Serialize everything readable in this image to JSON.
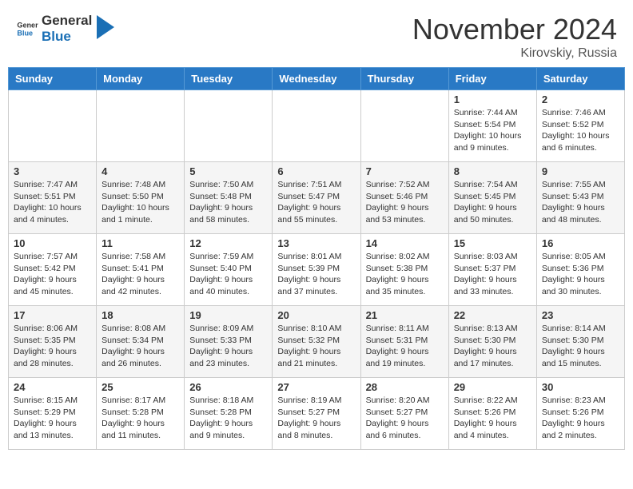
{
  "header": {
    "logo_line1": "General",
    "logo_line2": "Blue",
    "month": "November 2024",
    "location": "Kirovskiy, Russia"
  },
  "weekdays": [
    "Sunday",
    "Monday",
    "Tuesday",
    "Wednesday",
    "Thursday",
    "Friday",
    "Saturday"
  ],
  "weeks": [
    [
      {
        "day": "",
        "info": ""
      },
      {
        "day": "",
        "info": ""
      },
      {
        "day": "",
        "info": ""
      },
      {
        "day": "",
        "info": ""
      },
      {
        "day": "",
        "info": ""
      },
      {
        "day": "1",
        "info": "Sunrise: 7:44 AM\nSunset: 5:54 PM\nDaylight: 10 hours\nand 9 minutes."
      },
      {
        "day": "2",
        "info": "Sunrise: 7:46 AM\nSunset: 5:52 PM\nDaylight: 10 hours\nand 6 minutes."
      }
    ],
    [
      {
        "day": "3",
        "info": "Sunrise: 7:47 AM\nSunset: 5:51 PM\nDaylight: 10 hours\nand 4 minutes."
      },
      {
        "day": "4",
        "info": "Sunrise: 7:48 AM\nSunset: 5:50 PM\nDaylight: 10 hours\nand 1 minute."
      },
      {
        "day": "5",
        "info": "Sunrise: 7:50 AM\nSunset: 5:48 PM\nDaylight: 9 hours\nand 58 minutes."
      },
      {
        "day": "6",
        "info": "Sunrise: 7:51 AM\nSunset: 5:47 PM\nDaylight: 9 hours\nand 55 minutes."
      },
      {
        "day": "7",
        "info": "Sunrise: 7:52 AM\nSunset: 5:46 PM\nDaylight: 9 hours\nand 53 minutes."
      },
      {
        "day": "8",
        "info": "Sunrise: 7:54 AM\nSunset: 5:45 PM\nDaylight: 9 hours\nand 50 minutes."
      },
      {
        "day": "9",
        "info": "Sunrise: 7:55 AM\nSunset: 5:43 PM\nDaylight: 9 hours\nand 48 minutes."
      }
    ],
    [
      {
        "day": "10",
        "info": "Sunrise: 7:57 AM\nSunset: 5:42 PM\nDaylight: 9 hours\nand 45 minutes."
      },
      {
        "day": "11",
        "info": "Sunrise: 7:58 AM\nSunset: 5:41 PM\nDaylight: 9 hours\nand 42 minutes."
      },
      {
        "day": "12",
        "info": "Sunrise: 7:59 AM\nSunset: 5:40 PM\nDaylight: 9 hours\nand 40 minutes."
      },
      {
        "day": "13",
        "info": "Sunrise: 8:01 AM\nSunset: 5:39 PM\nDaylight: 9 hours\nand 37 minutes."
      },
      {
        "day": "14",
        "info": "Sunrise: 8:02 AM\nSunset: 5:38 PM\nDaylight: 9 hours\nand 35 minutes."
      },
      {
        "day": "15",
        "info": "Sunrise: 8:03 AM\nSunset: 5:37 PM\nDaylight: 9 hours\nand 33 minutes."
      },
      {
        "day": "16",
        "info": "Sunrise: 8:05 AM\nSunset: 5:36 PM\nDaylight: 9 hours\nand 30 minutes."
      }
    ],
    [
      {
        "day": "17",
        "info": "Sunrise: 8:06 AM\nSunset: 5:35 PM\nDaylight: 9 hours\nand 28 minutes."
      },
      {
        "day": "18",
        "info": "Sunrise: 8:08 AM\nSunset: 5:34 PM\nDaylight: 9 hours\nand 26 minutes."
      },
      {
        "day": "19",
        "info": "Sunrise: 8:09 AM\nSunset: 5:33 PM\nDaylight: 9 hours\nand 23 minutes."
      },
      {
        "day": "20",
        "info": "Sunrise: 8:10 AM\nSunset: 5:32 PM\nDaylight: 9 hours\nand 21 minutes."
      },
      {
        "day": "21",
        "info": "Sunrise: 8:11 AM\nSunset: 5:31 PM\nDaylight: 9 hours\nand 19 minutes."
      },
      {
        "day": "22",
        "info": "Sunrise: 8:13 AM\nSunset: 5:30 PM\nDaylight: 9 hours\nand 17 minutes."
      },
      {
        "day": "23",
        "info": "Sunrise: 8:14 AM\nSunset: 5:30 PM\nDaylight: 9 hours\nand 15 minutes."
      }
    ],
    [
      {
        "day": "24",
        "info": "Sunrise: 8:15 AM\nSunset: 5:29 PM\nDaylight: 9 hours\nand 13 minutes."
      },
      {
        "day": "25",
        "info": "Sunrise: 8:17 AM\nSunset: 5:28 PM\nDaylight: 9 hours\nand 11 minutes."
      },
      {
        "day": "26",
        "info": "Sunrise: 8:18 AM\nSunset: 5:28 PM\nDaylight: 9 hours\nand 9 minutes."
      },
      {
        "day": "27",
        "info": "Sunrise: 8:19 AM\nSunset: 5:27 PM\nDaylight: 9 hours\nand 8 minutes."
      },
      {
        "day": "28",
        "info": "Sunrise: 8:20 AM\nSunset: 5:27 PM\nDaylight: 9 hours\nand 6 minutes."
      },
      {
        "day": "29",
        "info": "Sunrise: 8:22 AM\nSunset: 5:26 PM\nDaylight: 9 hours\nand 4 minutes."
      },
      {
        "day": "30",
        "info": "Sunrise: 8:23 AM\nSunset: 5:26 PM\nDaylight: 9 hours\nand 2 minutes."
      }
    ]
  ]
}
